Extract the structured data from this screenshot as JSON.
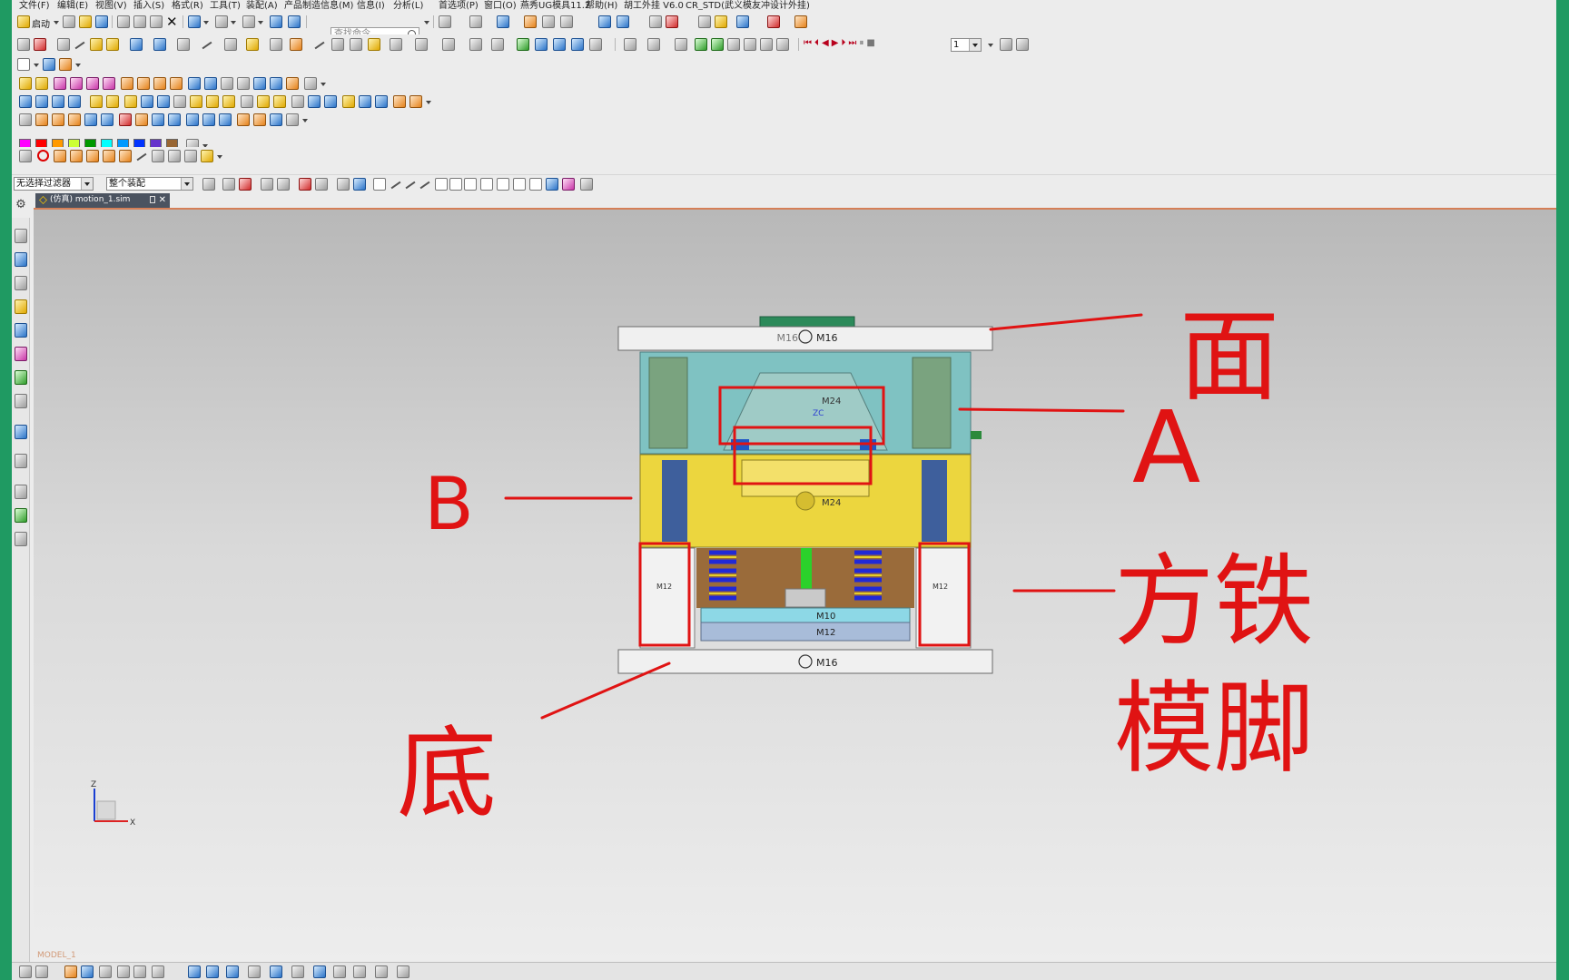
{
  "menu": [
    "文件(F)",
    "编辑(E)",
    "视图(V)",
    "插入(S)",
    "格式(R)",
    "工具(T)",
    "装配(A)",
    "产品制造信息(M)",
    "信息(I)",
    "分析(L)",
    "首选项(P)",
    "窗口(O)",
    "燕秀UG模具11.2",
    "帮助(H)",
    "胡工外挂 V6.0",
    "CR_STD(武义模友冲设计外挂)"
  ],
  "toolbar": {
    "start_label": "启动",
    "search_placeholder": "查找命令",
    "filter_combo": "无选择过滤器",
    "assembly_combo": "整个装配",
    "layer_combo": "1"
  },
  "palette_colors": [
    "#ff00ff",
    "#ff0000",
    "#ff9900",
    "#ccff33",
    "#009900",
    "#00ffff",
    "#0099ff",
    "#0033ff",
    "#6633cc",
    "#996633"
  ],
  "tab": {
    "title": "(仿真) motion_1.sim"
  },
  "viewport": {
    "model_name": "MODEL_1",
    "axis_x": "X",
    "axis_y": "Z",
    "zc_label": "ZC"
  },
  "mold_labels": {
    "top_plate": "M16",
    "top_plate_mirror": "M16",
    "a_plate": "M24",
    "b_plate": "M24",
    "left_block": "M12",
    "right_block": "M12",
    "ejector_upper": "M10",
    "ejector_lower": "M12",
    "bottom_plate": "M16"
  },
  "annotations": {
    "top": "面",
    "a": "A",
    "b": "B",
    "bottom": "底",
    "block": "方铁",
    "block2": "模脚"
  }
}
